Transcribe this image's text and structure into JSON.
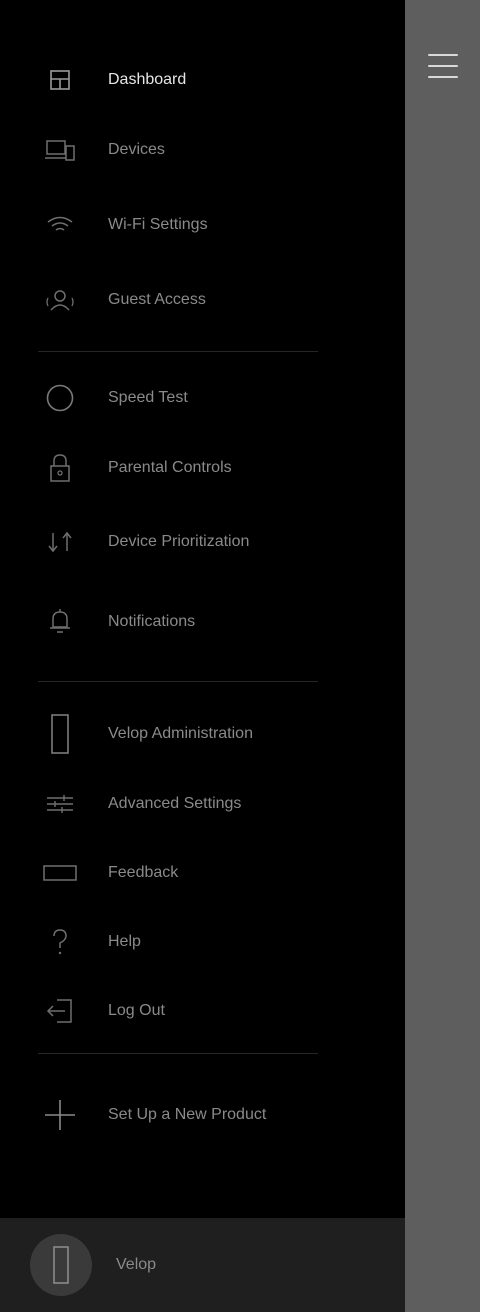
{
  "menu": {
    "group_primary": [
      {
        "label": "Dashboard",
        "icon": "dashboard-icon",
        "active": true
      },
      {
        "label": "Devices",
        "icon": "devices-icon",
        "active": false
      },
      {
        "label": "Wi-Fi Settings",
        "icon": "wifi-icon",
        "active": false
      },
      {
        "label": "Guest Access",
        "icon": "guest-icon",
        "active": false
      }
    ],
    "group_tools": [
      {
        "label": "Speed Test",
        "icon": "speed-test-icon"
      },
      {
        "label": "Parental Controls",
        "icon": "lock-icon"
      },
      {
        "label": "Device Prioritization",
        "icon": "prioritization-arrows-icon"
      },
      {
        "label": "Notifications",
        "icon": "bell-icon"
      }
    ],
    "group_admin": [
      {
        "label": "Velop Administration",
        "icon": "velop-node-icon"
      },
      {
        "label": "Advanced Settings",
        "icon": "sliders-icon"
      },
      {
        "label": "Feedback",
        "icon": "feedback-icon"
      },
      {
        "label": "Help",
        "icon": "question-icon"
      },
      {
        "label": "Log Out",
        "icon": "logout-icon"
      }
    ],
    "setup": {
      "label": "Set Up a New Product",
      "icon": "plus-icon"
    }
  },
  "footer": {
    "label": "Velop",
    "icon": "velop-node-icon"
  },
  "colors": {
    "drawer_bg": "#000000",
    "main_bg": "#5e5e5e",
    "footer_bg": "#1f1f1f",
    "active_text": "#e6e6e6",
    "inactive_text": "#8a8a8a",
    "icon_stroke": "#6f6f6f"
  }
}
